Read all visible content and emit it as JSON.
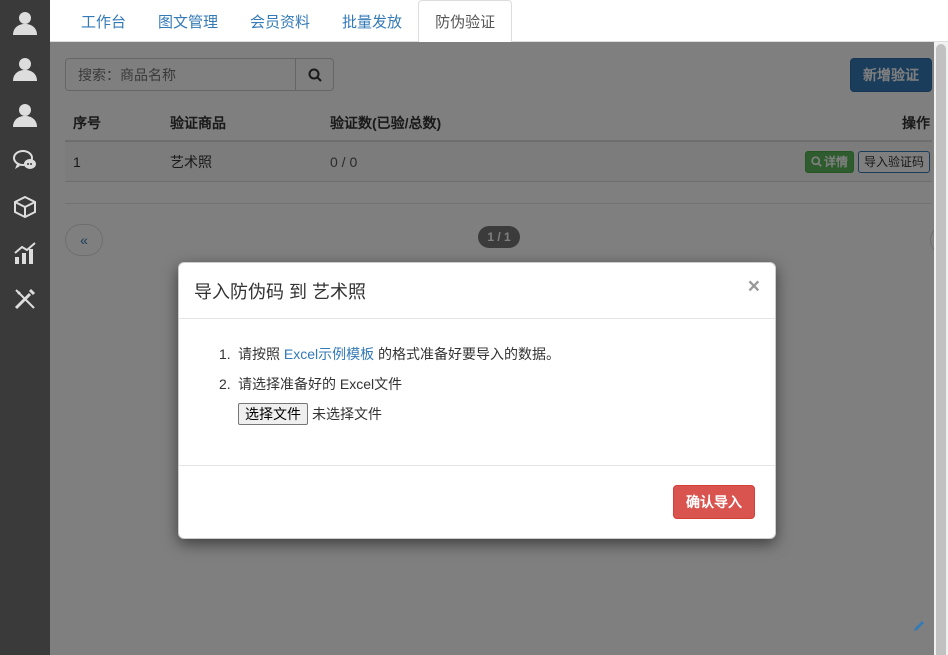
{
  "sidebar": {
    "items": [
      {
        "icon": "user-icon"
      },
      {
        "icon": "user-icon"
      },
      {
        "icon": "user-icon"
      },
      {
        "icon": "chat-icon"
      },
      {
        "icon": "box-icon"
      },
      {
        "icon": "chart-icon"
      },
      {
        "icon": "tools-icon"
      }
    ]
  },
  "tabs": [
    {
      "label": "工作台"
    },
    {
      "label": "图文管理"
    },
    {
      "label": "会员资料"
    },
    {
      "label": "批量发放"
    },
    {
      "label": "防伪验证",
      "active": true
    }
  ],
  "search": {
    "placeholder": "搜索：商品名称"
  },
  "add_button": "新增验证",
  "table": {
    "headers": [
      "序号",
      "验证商品",
      "验证数(已验/总数)",
      "操作"
    ],
    "rows": [
      {
        "index": "1",
        "product": "艺术照",
        "count": "0 / 0",
        "detail": "详情",
        "import": "导入验证码"
      }
    ]
  },
  "pager": {
    "prev": "«",
    "info": "1 / 1",
    "next": "»"
  },
  "modal": {
    "title": "导入防伪码 到 艺术照",
    "close": "×",
    "step1_num": "1.",
    "step1_prefix": "请按照 ",
    "step1_link": "Excel示例模板",
    "step1_suffix": " 的格式准备好要导入的数据。",
    "step2_num": "2.",
    "step2_text": "请选择准备好的 Excel文件",
    "file_button": "选择文件",
    "file_status": "未选择文件",
    "confirm": "确认导入"
  },
  "colors": {
    "primary": "#337ab7",
    "success": "#5cb85c",
    "danger": "#d9534f",
    "sidebar": "#3a3a3a"
  }
}
